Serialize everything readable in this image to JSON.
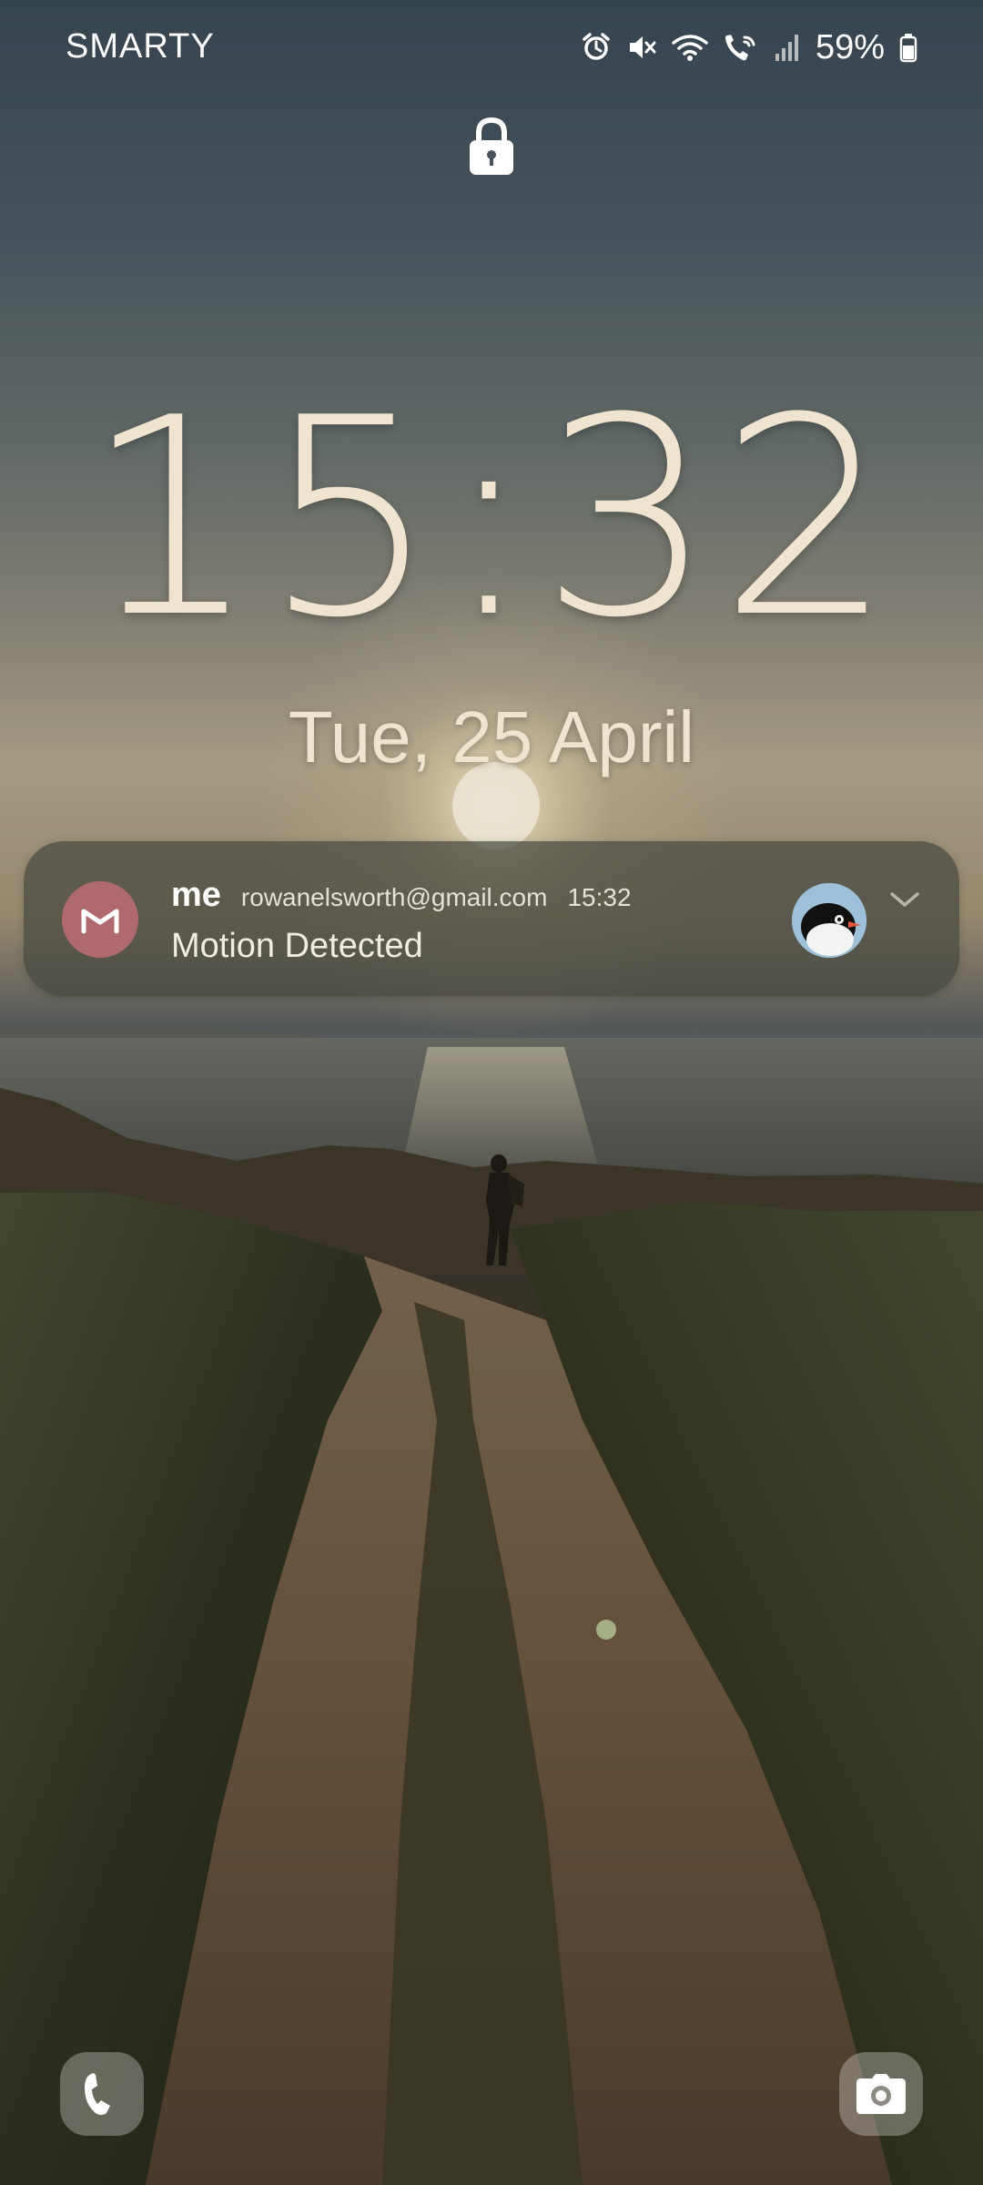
{
  "status_bar": {
    "carrier": "SMARTY",
    "battery_percent": "59%",
    "icons": [
      "alarm-icon",
      "mute-icon",
      "wifi-icon",
      "wifi-calling-icon",
      "signal-icon",
      "battery-icon"
    ]
  },
  "lock": {
    "icon": "lock-icon"
  },
  "clock": {
    "time": "15:32",
    "date": "Tue, 25 April"
  },
  "notification": {
    "app_icon": "gmail-icon",
    "sender": "me",
    "email": "rowanelsworth@gmail.com",
    "time": "15:32",
    "body": "Motion Detected",
    "avatar": "penguin-avatar",
    "expand_icon": "chevron-down-icon"
  },
  "shortcuts": {
    "left": "phone-icon",
    "right": "camera-icon"
  },
  "colors": {
    "clock_text": "#efe4cf",
    "notification_bg": "#464840",
    "gmail_badge": "#b06a6f"
  }
}
